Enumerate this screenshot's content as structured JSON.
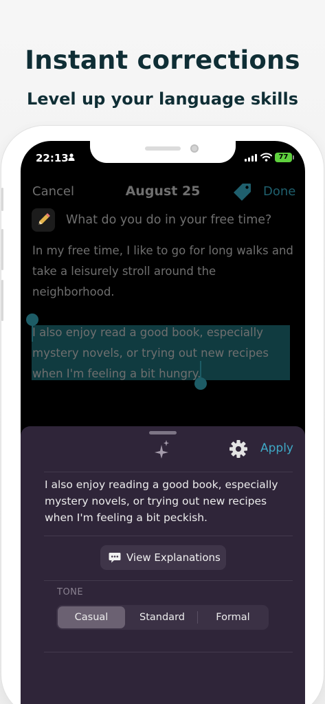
{
  "promo": {
    "headline": "Instant corrections",
    "subheadline": "Level up your language skills"
  },
  "status_bar": {
    "time": "22:13",
    "battery": "77"
  },
  "nav": {
    "cancel": "Cancel",
    "date": "August 25",
    "done": "Done"
  },
  "entry": {
    "prompt_icon": "pencil-icon",
    "prompt": "What do you do in your free time?",
    "paragraph1": "In my free time, I like to go for long walks and take a leisurely stroll around the neighborhood.",
    "paragraph2": "I also enjoy read a good book, especially mystery novels, or trying out new recipes when I'm feeling a bit hungry."
  },
  "sheet": {
    "apply": "Apply",
    "corrected_text": "I also enjoy reading a good book, especially mystery novels, or trying out new recipes when I'm feeling a bit peckish.",
    "view_explanations": "View Explanations",
    "tone_label": "TONE",
    "tones": [
      "Casual",
      "Standard",
      "Formal"
    ],
    "selected_tone": "Casual"
  },
  "colors": {
    "accent": "#3fa9c6",
    "selection": "#103b40",
    "sheet_bg": "#2f2539",
    "headline": "#0f2e35"
  }
}
